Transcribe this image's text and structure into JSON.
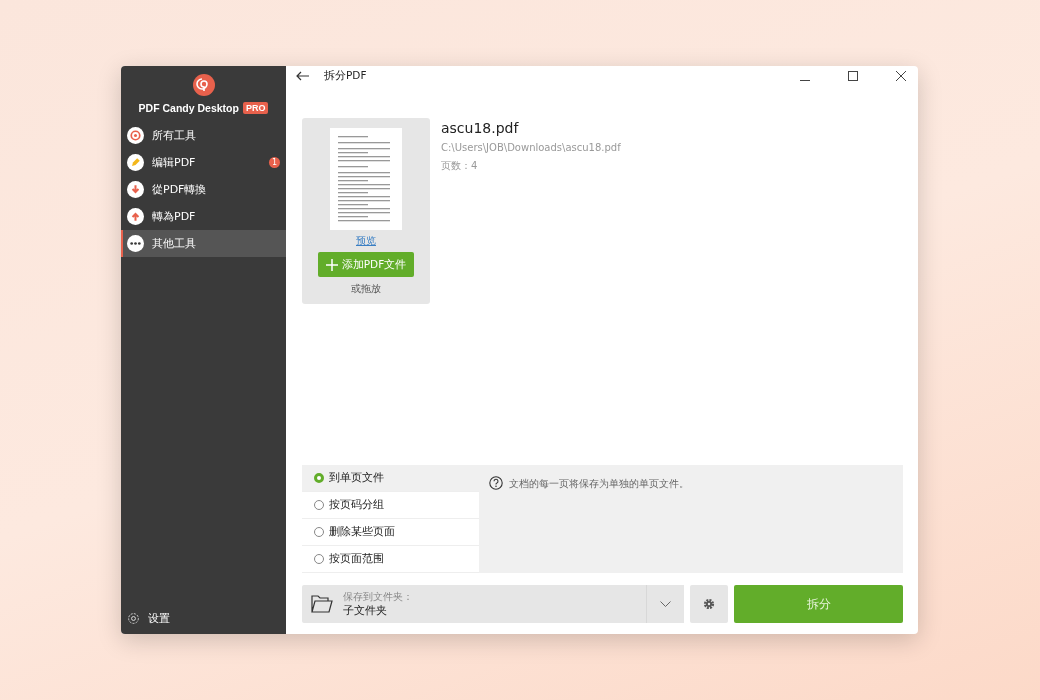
{
  "sidebar": {
    "logo": "PDF Candy Desktop",
    "badge": "PRO",
    "items": [
      {
        "label": "所有工具",
        "selected": false,
        "kind": "all"
      },
      {
        "label": "编辑PDF",
        "selected": false,
        "kind": "edit",
        "count": "1"
      },
      {
        "label": "從PDF轉換",
        "selected": false,
        "kind": "from"
      },
      {
        "label": "轉為PDF",
        "selected": false,
        "kind": "to"
      },
      {
        "label": "其他工具",
        "selected": true,
        "kind": "more"
      }
    ],
    "footer": "设置"
  },
  "header": {
    "title": "拆分PDF"
  },
  "file": {
    "preview_link": "预览",
    "add_button": "添加PDF文件",
    "drop_hint": "或拖放",
    "name": "ascu18.pdf",
    "path": "C:\\Users\\JOB\\Downloads\\ascu18.pdf",
    "pages": "页数：4"
  },
  "modes": [
    {
      "label": "到单页文件",
      "selected": true
    },
    {
      "label": "按页码分组",
      "selected": false
    },
    {
      "label": "删除某些页面",
      "selected": false
    },
    {
      "label": "按页面范围",
      "selected": false
    }
  ],
  "description": "文档的每一页将保存为单独的单页文件。",
  "output": {
    "label": "保存到文件夹：",
    "value": "子文件夹"
  },
  "split_button": "拆分"
}
